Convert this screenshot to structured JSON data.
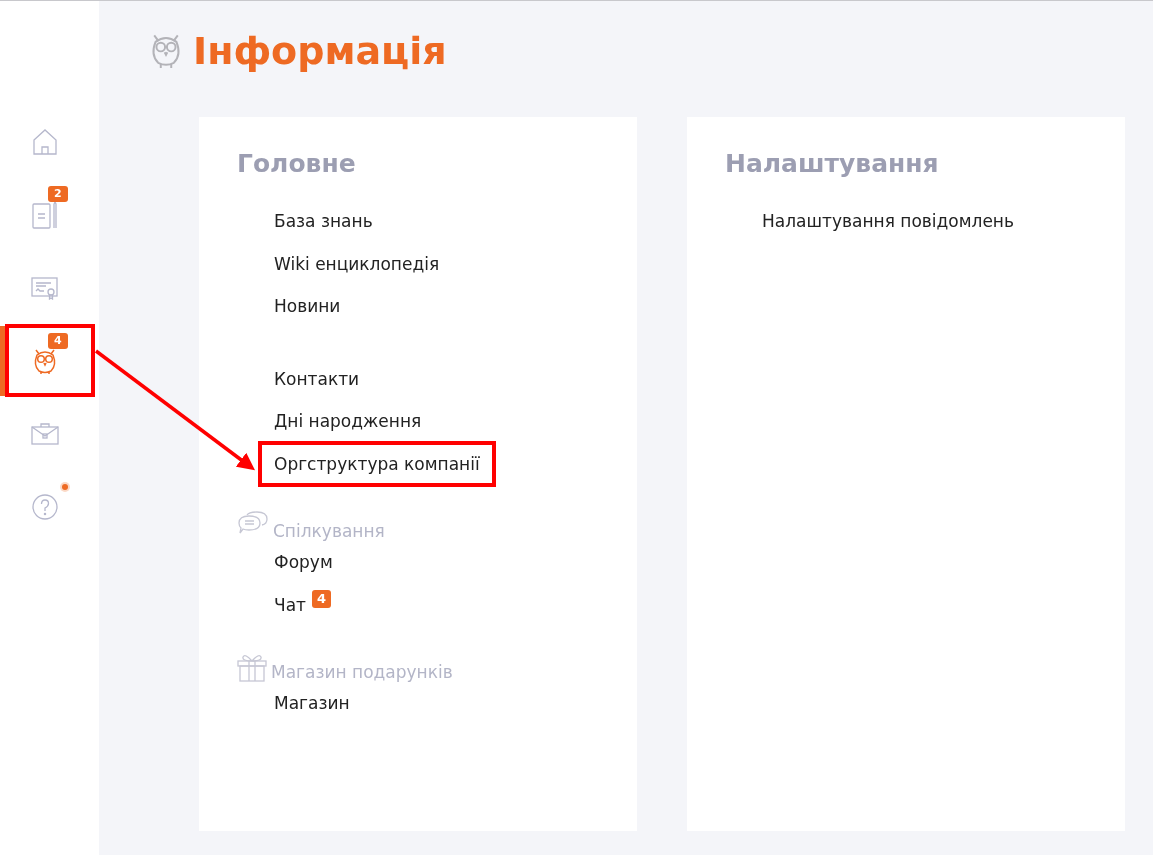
{
  "sidebar": {
    "items": [
      {
        "kind": "home",
        "selected": false,
        "highlighted": false
      },
      {
        "kind": "notebook",
        "badge": "2",
        "selected": false,
        "highlighted": false
      },
      {
        "kind": "certificate",
        "selected": false,
        "highlighted": false
      },
      {
        "kind": "owl",
        "badge": "4",
        "selected": true,
        "highlighted": true
      },
      {
        "kind": "briefcase",
        "selected": false,
        "highlighted": false
      },
      {
        "kind": "help",
        "dot": true,
        "selected": false,
        "highlighted": false
      }
    ]
  },
  "page": {
    "title": "Інформація"
  },
  "cards": [
    {
      "title": "Головне",
      "groups": [
        {
          "items": [
            {
              "label": "База знань",
              "highlighted": false
            },
            {
              "label": "Wiki енциклопедія",
              "highlighted": false
            },
            {
              "label": "Новини",
              "highlighted": false
            }
          ]
        },
        {
          "items": [
            {
              "label": "Контакти",
              "highlighted": false
            },
            {
              "label": "Дні народження",
              "highlighted": false
            },
            {
              "label": "Оргструктура компанії",
              "highlighted": true
            }
          ]
        },
        {
          "heading": "Спілкування",
          "kind": "chat",
          "items": [
            {
              "label": "Форум",
              "highlighted": false
            },
            {
              "label": "Чат",
              "badge": "4",
              "highlighted": false
            }
          ]
        },
        {
          "heading": "Магазин подарунків",
          "kind": "gift",
          "items": [
            {
              "label": "Магазин",
              "highlighted": false
            }
          ]
        }
      ]
    },
    {
      "title": "Налаштування",
      "groups": [
        {
          "items": [
            {
              "label": "Налаштування повідомлень",
              "highlighted": false
            }
          ]
        }
      ]
    }
  ],
  "annotation": {
    "arrow": true
  }
}
